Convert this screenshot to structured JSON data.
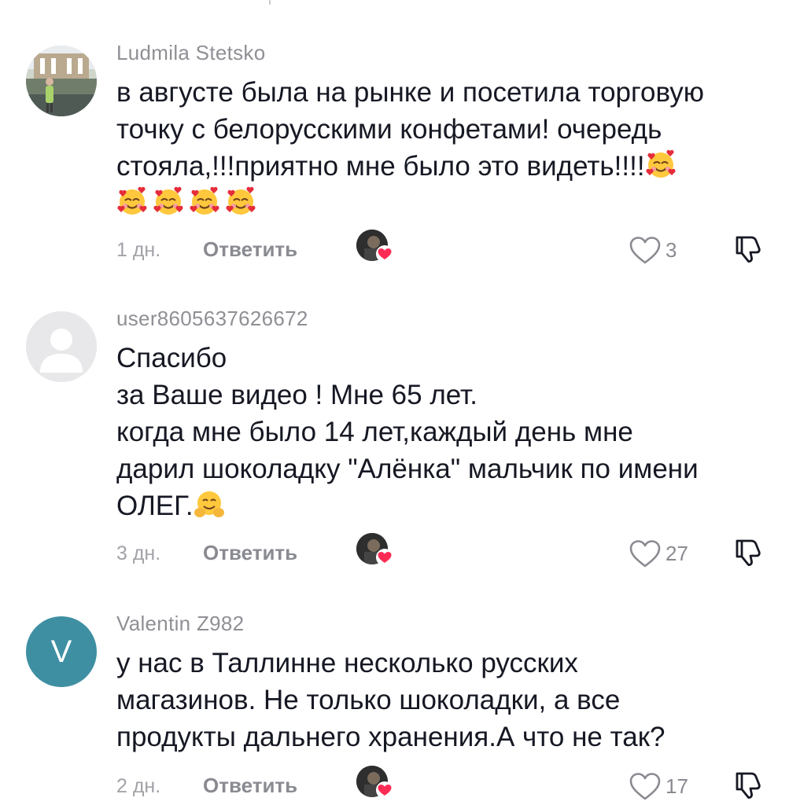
{
  "comments": [
    {
      "username": "Ludmila Stetsko",
      "avatar_type": "photo",
      "text_lines": [
        "в августе была на рынке и посетила торговую",
        "точку с белорусскими конфетами! очередь",
        "стояла,!!!приятно мне было это видеть!!!!"
      ],
      "emoji": "smiling-face-with-hearts",
      "emoji_count_inline": 1,
      "emoji_count_next_line": 4,
      "time": "1 дн.",
      "reply_label": "Ответить",
      "likes": "3"
    },
    {
      "username": "user8605637626672",
      "avatar_type": "default",
      "text_lines": [
        "Спасибо",
        "за Ваше видео ! Мне 65 лет.",
        "когда мне было 14 лет,каждый день мне",
        "дарил шоколадку \"Алёнка\" мальчик по имени",
        "ОЛЕГ."
      ],
      "emoji": "hugging-face",
      "time": "3 дн.",
      "reply_label": "Ответить",
      "likes": "27"
    },
    {
      "username": "Valentin Z982",
      "avatar_type": "letter",
      "avatar_letter": "V",
      "avatar_color": "#3f8fa3",
      "text_lines": [
        "у нас в Таллинне несколько русских",
        "магазинов. Не только шоколадки, а все",
        "продукты дальнего хранения.А что не так?"
      ],
      "time": "2 дн.",
      "reply_label": "Ответить",
      "likes": "17"
    }
  ],
  "icons": {
    "like": "heart-outline-icon",
    "dislike": "thumbs-down-icon",
    "creator_liked": "creator-liked-heart-icon"
  },
  "colors": {
    "username": "#8f8f95",
    "text": "#161823",
    "meta": "#8a8b91",
    "creator_heart": "#fe2c55"
  }
}
